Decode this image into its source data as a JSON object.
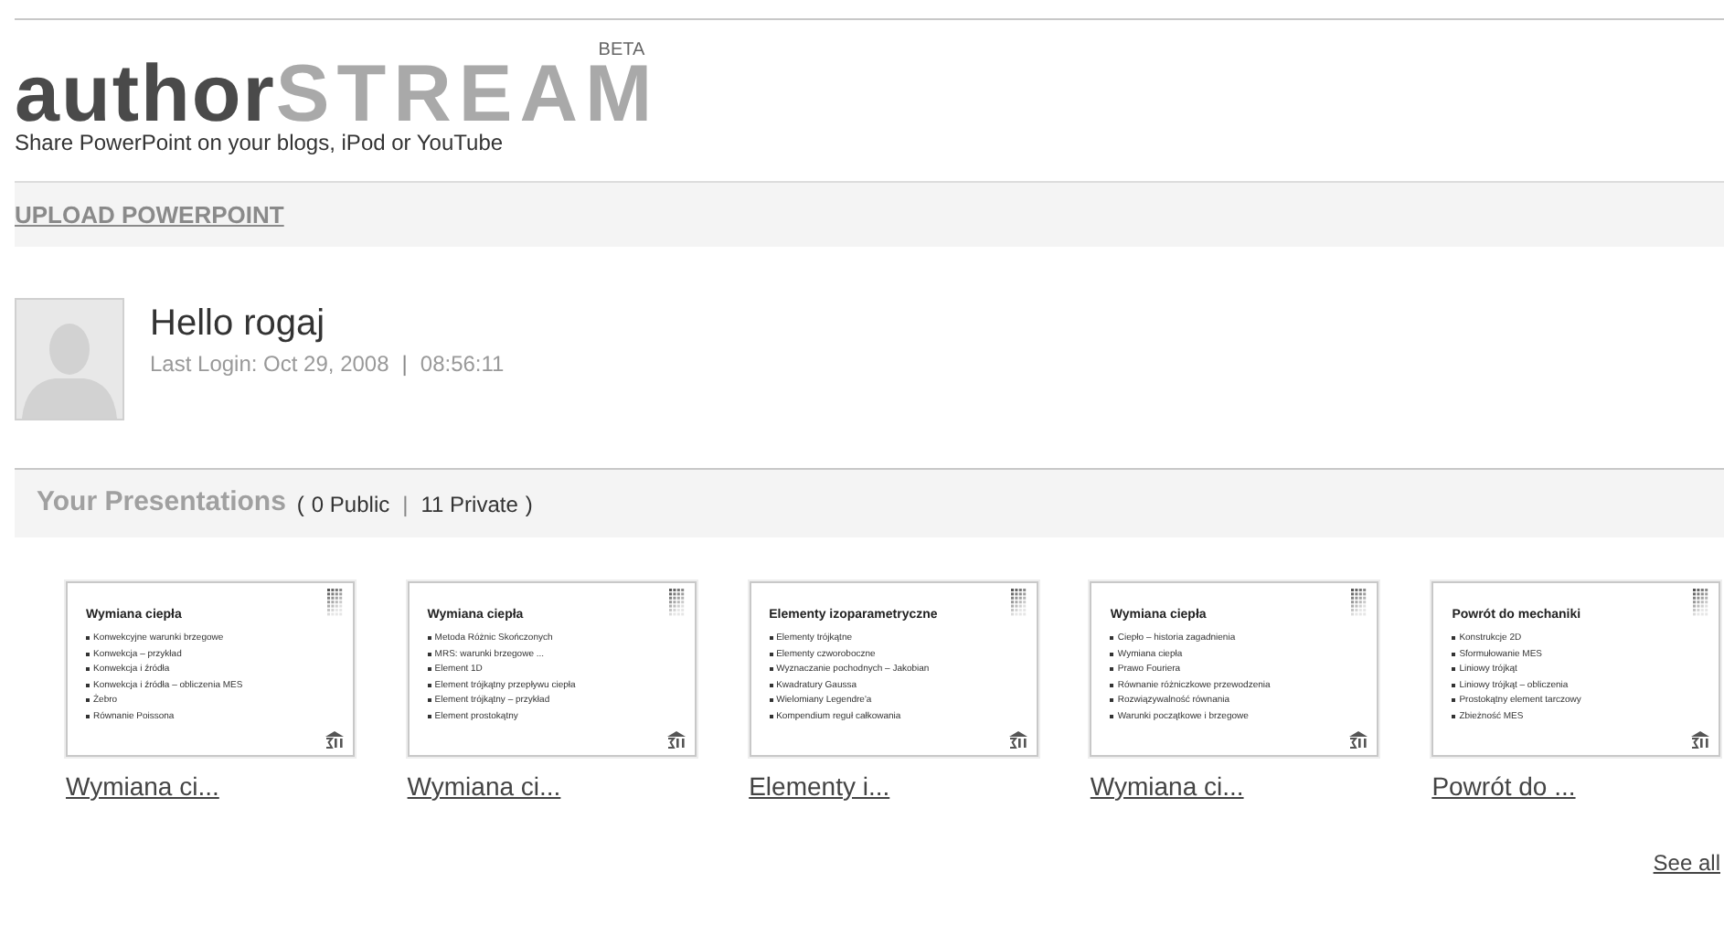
{
  "header": {
    "logo_part_1": "author",
    "logo_part_2": "STREAM",
    "badge": "BETA",
    "tagline": "Share PowerPoint on your blogs, iPod or YouTube"
  },
  "upload_link": "UPLOAD POWERPOINT",
  "user": {
    "greeting": "Hello rogaj",
    "last_login_label": "Last Login: Oct 29, 2008",
    "separator": "|",
    "last_login_time": "08:56:11"
  },
  "presentations": {
    "title": "Your Presentations",
    "open_paren": "(",
    "public_count": "0 Public",
    "separator": "|",
    "private_count": "11 Private",
    "close_paren": ")",
    "items": [
      {
        "slide_title": "Wymiana ciepła",
        "bullets": [
          "Konwekcyjne warunki brzegowe",
          "Konwekcja – przykład",
          "Konwekcja i źródła",
          "Konwekcja i źródła – obliczenia MES",
          "Żebro",
          "Równanie Poissona"
        ],
        "caption": "Wymiana ci..."
      },
      {
        "slide_title": "Wymiana ciepła",
        "bullets": [
          "Metoda Różnic Skończonych",
          "MRS: warunki brzegowe ...",
          "Element 1D",
          "Element trójkątny przepływu ciepła",
          "Element trójkątny – przykład",
          "Element prostokątny"
        ],
        "caption": "Wymiana ci..."
      },
      {
        "slide_title": "Elementy izoparametryczne",
        "bullets": [
          "Elementy trójkątne",
          "Elementy czworoboczne",
          "Wyznaczanie pochodnych – Jakobian",
          "Kwadratury Gaussa",
          "Wielomiany Legendre'a",
          "Kompendium reguł całkowania"
        ],
        "caption": "Elementy i..."
      },
      {
        "slide_title": "Wymiana ciepła",
        "bullets": [
          "Ciepło – historia zagadnienia",
          "Wymiana ciepła",
          "Prawo Fouriera",
          "Równanie różniczkowe przewodzenia",
          "Rozwiązywalność równania",
          "Warunki początkowe i brzegowe"
        ],
        "caption": "Wymiana ci..."
      },
      {
        "slide_title": "Powrót do mechaniki",
        "bullets": [
          "Konstrukcje 2D",
          "Sformułowanie MES",
          "Liniowy trójkąt",
          "Liniowy trójkąt – obliczenia",
          "Prostokątny element tarczowy",
          "Zbieżność MES"
        ],
        "caption": "Powrót do ..."
      }
    ],
    "see_all": "See all"
  }
}
